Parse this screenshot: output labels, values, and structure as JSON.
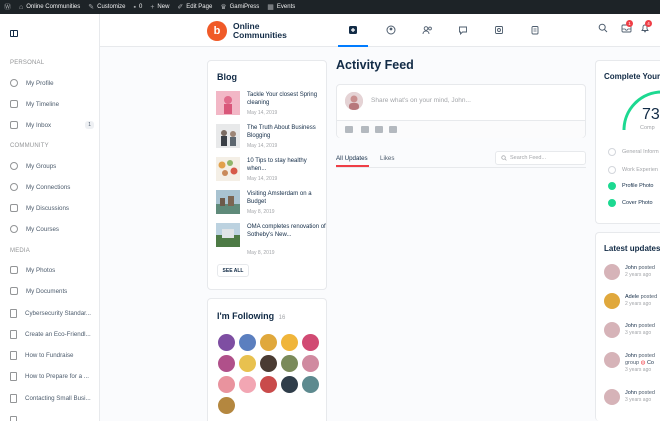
{
  "adminbar": {
    "items": [
      {
        "icon": "wordpress-icon",
        "label": ""
      },
      {
        "icon": "home-icon",
        "label": "Online Communities"
      },
      {
        "icon": "brush-icon",
        "label": "Customize"
      },
      {
        "icon": "comment-icon",
        "label": "0"
      },
      {
        "icon": "plus-icon",
        "label": "New"
      },
      {
        "icon": "pencil-icon",
        "label": "Edit Page"
      },
      {
        "icon": "crown-icon",
        "label": "GamiPress"
      },
      {
        "icon": "calendar-icon",
        "label": "Events"
      }
    ]
  },
  "sidebar": {
    "section_personal": "PERSONAL",
    "section_community": "COMMUNITY",
    "section_media": "MEDIA",
    "personal": [
      {
        "label": "My Profile",
        "icon": "user-icon"
      },
      {
        "label": "My Timeline",
        "icon": "timeline-icon"
      },
      {
        "label": "My Inbox",
        "icon": "inbox-icon",
        "badge": "1"
      }
    ],
    "community": [
      {
        "label": "My Groups",
        "icon": "groups-icon"
      },
      {
        "label": "My Connections",
        "icon": "connections-icon"
      },
      {
        "label": "My Discussions",
        "icon": "discussions-icon"
      },
      {
        "label": "My Courses",
        "icon": "courses-icon"
      }
    ],
    "media": [
      {
        "label": "My Photos",
        "icon": "photos-icon"
      },
      {
        "label": "My Documents",
        "icon": "documents-icon"
      },
      {
        "label": "Cybersecurity Standar...",
        "icon": "page-icon"
      },
      {
        "label": "Create an Eco-Friendl...",
        "icon": "page-icon"
      },
      {
        "label": "How to Fundraise",
        "icon": "page-icon"
      },
      {
        "label": "How to Prepare for a ...",
        "icon": "page-icon"
      },
      {
        "label": "Contacting Small Busi...",
        "icon": "page-icon"
      }
    ]
  },
  "header": {
    "logo_letter": "b",
    "site_name": "Online Communities",
    "nav_icons": [
      "activity-icon",
      "profile-icon",
      "members-icon",
      "forums-icon",
      "media-icon",
      "clipboard-icon"
    ],
    "notif_count_1": "1",
    "notif_count_2": "4"
  },
  "blog": {
    "title": "Blog",
    "see_all": "SEE ALL",
    "posts": [
      {
        "title": "Tackle Your closest Spring cleaning",
        "date": "May 14, 2019",
        "color": "#e88aa3"
      },
      {
        "title": "The Truth About Business Blogging",
        "date": "May 14, 2019",
        "color": "#8a8f96"
      },
      {
        "title": "10 Tips to stay healthy when...",
        "date": "May 14, 2019",
        "color": "#c9a27a"
      },
      {
        "title": "Visiting Amsterdam on a Budget",
        "date": "May 8, 2019",
        "color": "#6f9aa8"
      },
      {
        "title": "OMA completes renovation of Sotheby's New...",
        "date": "May 8, 2019",
        "color": "#5f8a57"
      }
    ]
  },
  "following": {
    "title": "I'm Following",
    "count": "16"
  },
  "activity": {
    "title": "Activity Feed",
    "placeholder": "Share what's on your mind, John...",
    "tab_all": "All Updates",
    "tab_likes": "Likes",
    "search_placeholder": "Search Feed..."
  },
  "profile_progress": {
    "title": "Complete Your",
    "percent": "73",
    "sub": "Comp",
    "items": [
      {
        "label": "General Inform",
        "done": false
      },
      {
        "label": "Work Experien",
        "done": false
      },
      {
        "label": "Profile Photo",
        "done": true
      },
      {
        "label": "Cover Photo",
        "done": true
      }
    ]
  },
  "latest_updates": {
    "title": "Latest updates",
    "items": [
      {
        "name": "John",
        "action": "posted",
        "time": "2 years ago"
      },
      {
        "name": "Adele",
        "action": "posted",
        "time": "2 years ago"
      },
      {
        "name": "John",
        "action": "posted",
        "time": "3 years ago"
      },
      {
        "name": "John",
        "action": "posted",
        "line2": "group",
        "extra": "Co",
        "time": "3 years ago"
      },
      {
        "name": "John",
        "action": "posted",
        "time": "3 years ago"
      }
    ]
  },
  "colors": {
    "accent": "#007cff",
    "brand": "#f05a28",
    "notification": "#ef3e46",
    "success": "#1cd991"
  }
}
